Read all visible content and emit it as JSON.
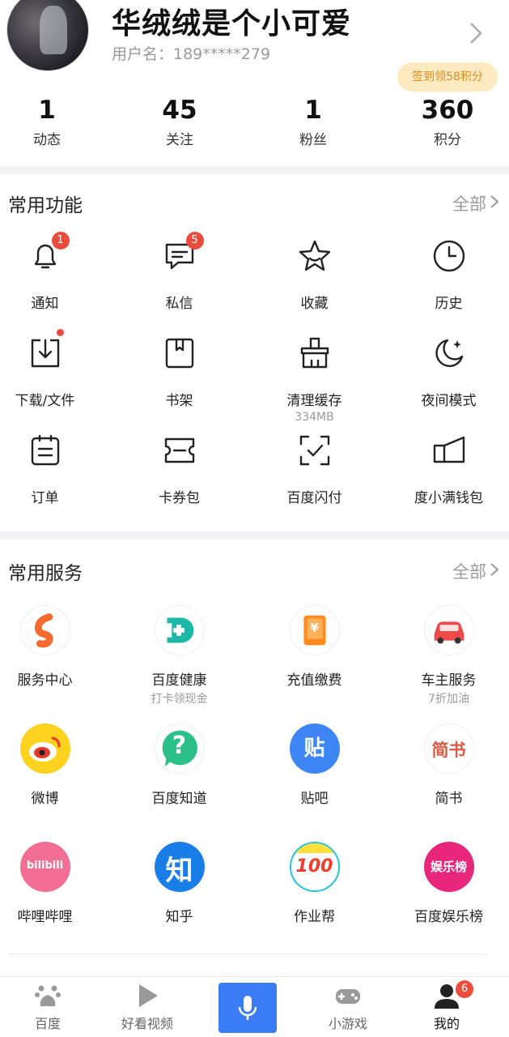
{
  "profile": {
    "username": "华绒绒是个小可爱",
    "userid": "用户名：189*****279",
    "sign_badge": "签到领58积分"
  },
  "stats": [
    {
      "num": "1",
      "label": "动态"
    },
    {
      "num": "45",
      "label": "关注"
    },
    {
      "num": "1",
      "label": "粉丝"
    },
    {
      "num": "360",
      "label": "积分"
    }
  ],
  "functions": {
    "title": "常用功能",
    "more": "全部",
    "items": [
      {
        "label": "通知",
        "icon": "bell-icon",
        "badge": "1"
      },
      {
        "label": "私信",
        "icon": "message-icon",
        "badge": "5"
      },
      {
        "label": "收藏",
        "icon": "star-icon"
      },
      {
        "label": "历史",
        "icon": "clock-icon"
      },
      {
        "label": "下载/文件",
        "icon": "download-icon"
      },
      {
        "label": "书架",
        "icon": "bookshelf-icon"
      },
      {
        "label": "清理缓存",
        "icon": "broom-icon",
        "sub": "334MB"
      },
      {
        "label": "夜间模式",
        "icon": "moon-icon"
      },
      {
        "label": "订单",
        "icon": "order-icon"
      },
      {
        "label": "卡券包",
        "icon": "coupon-icon"
      },
      {
        "label": "百度闪付",
        "icon": "scan-pay-icon"
      },
      {
        "label": "度小满钱包",
        "icon": "wallet-icon"
      }
    ]
  },
  "services": {
    "title": "常用服务",
    "more": "全部",
    "items": [
      {
        "label": "服务中心",
        "icon": "service-center-icon"
      },
      {
        "label": "百度健康",
        "icon": "health-icon",
        "sub": "打卡领现金"
      },
      {
        "label": "充值缴费",
        "icon": "recharge-icon",
        "glyph": "¥"
      },
      {
        "label": "车主服务",
        "icon": "car-icon",
        "sub": "7折加油"
      },
      {
        "label": "微博",
        "icon": "weibo-icon"
      },
      {
        "label": "百度知道",
        "icon": "zhidao-icon",
        "glyph": "?"
      },
      {
        "label": "贴吧",
        "icon": "tieba-icon",
        "glyph": "贴"
      },
      {
        "label": "简书",
        "icon": "jianshu-icon",
        "glyph": "简书"
      },
      {
        "label": "哔哩哔哩",
        "icon": "bilibili-icon",
        "glyph": "bilibili"
      },
      {
        "label": "知乎",
        "icon": "zhihu-icon",
        "glyph": "知"
      },
      {
        "label": "作业帮",
        "icon": "zuoyebang-icon",
        "glyph": "100"
      },
      {
        "label": "百度娱乐榜",
        "icon": "yule-icon",
        "glyph": "娱乐榜"
      }
    ]
  },
  "bottom_nav": [
    {
      "label": "百度",
      "icon": "baidu-paw-icon"
    },
    {
      "label": "好看视频",
      "icon": "play-icon"
    },
    {
      "label": "",
      "icon": "microphone-icon"
    },
    {
      "label": "小游戏",
      "icon": "gamepad-icon"
    },
    {
      "label": "我的",
      "icon": "user-icon",
      "badge": "6"
    }
  ],
  "colors": {
    "accent_blue": "#3a7cf6",
    "badge_red": "#e94b3c",
    "sign_bg": "#fdeac1",
    "sign_text": "#e08a1a"
  }
}
